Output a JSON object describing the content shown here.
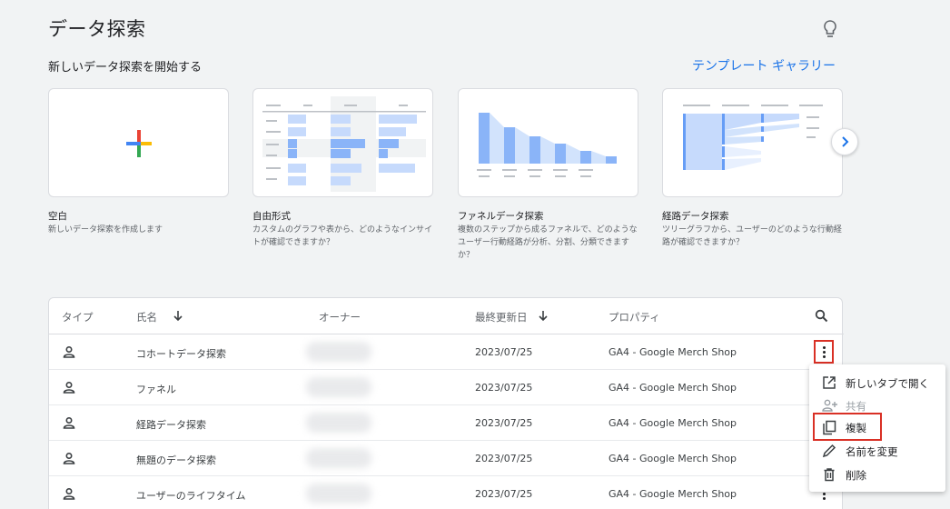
{
  "header": {
    "title": "データ探索",
    "subtitle": "新しいデータ探索を開始する",
    "gallery_link": "テンプレート ギャラリー",
    "bulb_icon": "lightbulb-icon"
  },
  "templates": [
    {
      "title": "空白",
      "description": "新しいデータ探索を作成します"
    },
    {
      "title": "自由形式",
      "description": "カスタムのグラフや表から、どのようなインサイトが確認できますか？"
    },
    {
      "title": "ファネルデータ探索",
      "description": "複数のステップから成るファネルで、どのようなユーザー行動経路が分析、分割、分類できますか？"
    },
    {
      "title": "経路データ探索",
      "description": "ツリーグラフから、ユーザーのどのような行動経路が確認できますか？"
    }
  ],
  "table": {
    "columns": [
      "タイプ",
      "氏名",
      "オーナー",
      "最終更新日",
      "プロパティ"
    ],
    "rows": [
      {
        "name": "コホートデータ探索",
        "date": "2023/07/25",
        "property": "GA4 - Google Merch Shop"
      },
      {
        "name": "ファネル",
        "date": "2023/07/25",
        "property": "GA4 - Google Merch Shop"
      },
      {
        "name": "経路データ探索",
        "date": "2023/07/25",
        "property": "GA4 - Google Merch Shop"
      },
      {
        "name": "無題のデータ探索",
        "date": "2023/07/25",
        "property": "GA4 - Google Merch Shop"
      },
      {
        "name": "ユーザーのライフタイム",
        "date": "2023/07/25",
        "property": "GA4 - Google Merch Shop"
      }
    ]
  },
  "context_menu": {
    "items": [
      {
        "label": "新しいタブで開く",
        "icon": "open-in-new-icon",
        "enabled": true
      },
      {
        "label": "共有",
        "icon": "share-person-icon",
        "enabled": false
      },
      {
        "label": "複製",
        "icon": "copy-icon",
        "enabled": true,
        "highlighted": true
      },
      {
        "label": "名前を変更",
        "icon": "pencil-icon",
        "enabled": true
      },
      {
        "label": "削除",
        "icon": "trash-icon",
        "enabled": true
      }
    ]
  },
  "colors": {
    "accent": "#1a73e8",
    "bar_blue": "#8ab4f8",
    "bar_blue_dark": "#669df6",
    "highlight_red": "#d93025",
    "google_red": "#ea4335",
    "google_blue": "#4285f4",
    "google_yellow": "#fbbc04",
    "google_green": "#34a853"
  }
}
